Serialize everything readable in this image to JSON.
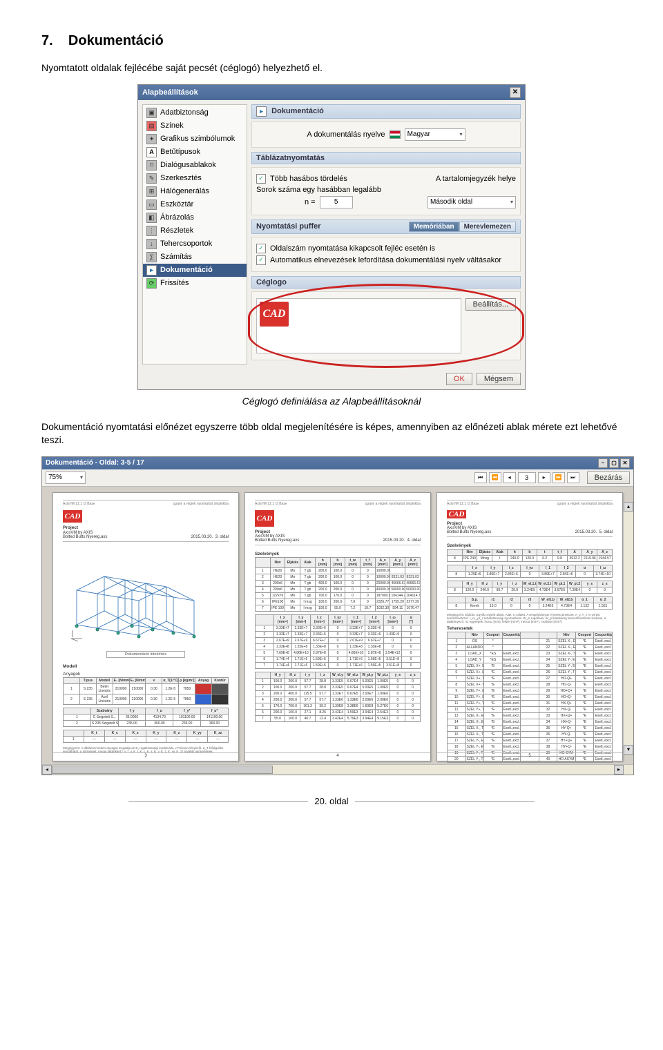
{
  "section": {
    "number": "7.",
    "title": "Dokumentáció"
  },
  "para1": "Nyomtatott oldalak fejlécébe saját pecsét (céglogó) helyezhető el.",
  "caption1": "Céglogó definiálása az Alapbeállításoknál",
  "para2": "Dokumentáció nyomtatási előnézet egyszerre több oldal megjelenítésére is képes, amennyiben az előnézeti ablak mérete ezt lehetővé teszi.",
  "footer": "20. oldal",
  "dlg": {
    "title": "Alapbeállítások",
    "lang_label": "A dokumentálás nyelve",
    "lang_value": "Magyar",
    "hdr_doc": "Dokumentáció",
    "hdr_tbl": "Táblázatnyomtatás",
    "hdr_buf": "Nyomtatási puffer",
    "hdr_logo": "Céglogo",
    "chk_tord": "Több hasábos tördelés",
    "rows_label": "Sorok száma egy hasábban legalább",
    "n_label": "n =",
    "n_value": "5",
    "toc_label": "A tartalomjegyzék helye",
    "toc_value": "Második oldal",
    "buf_mem": "Memóriában",
    "buf_disk": "Merevlemezen",
    "chk_pgnum": "Oldalszám nyomtatása kikapcsolt fejléc esetén is",
    "chk_auto": "Automatikus elnevezések lefordítása dokumentálási nyelv váltásakor",
    "btn_set": "Beállítás...",
    "btn_ok": "OK",
    "btn_cancel": "Mégsem",
    "sidebar": [
      "Adatbiztonság",
      "Színek",
      "Grafikus szimbólumok",
      "Betűtípusok",
      "Dialógusablakok",
      "Szerkesztés",
      "Hálógenerálás",
      "Eszköztár",
      "Ábrázolás",
      "Részletek",
      "Tehercsoportok",
      "Számítás",
      "Dokumentáció",
      "Frissítés"
    ]
  },
  "pv": {
    "title": "Dokumentáció - Oldal: 3-5 / 17",
    "zoom": "75%",
    "page_input": "3",
    "close": "Bezárás",
    "page_numbers": [
      "3",
      "4",
      "5"
    ],
    "project_label": "Project",
    "project_name": "AxisVM by AXIS",
    "project_file": "Bolted Butts Nyereg.axs",
    "date": "2015.03.20.",
    "versions": [
      "3. oldal",
      "4. oldal",
      "5. oldal"
    ],
    "modell": "Modell",
    "anyagok": "Anyagok",
    "szelvenyek": "Szelvények",
    "terhek": "Teheresetek",
    "wireframe_caption": "Dokumentáció áttekintés"
  }
}
